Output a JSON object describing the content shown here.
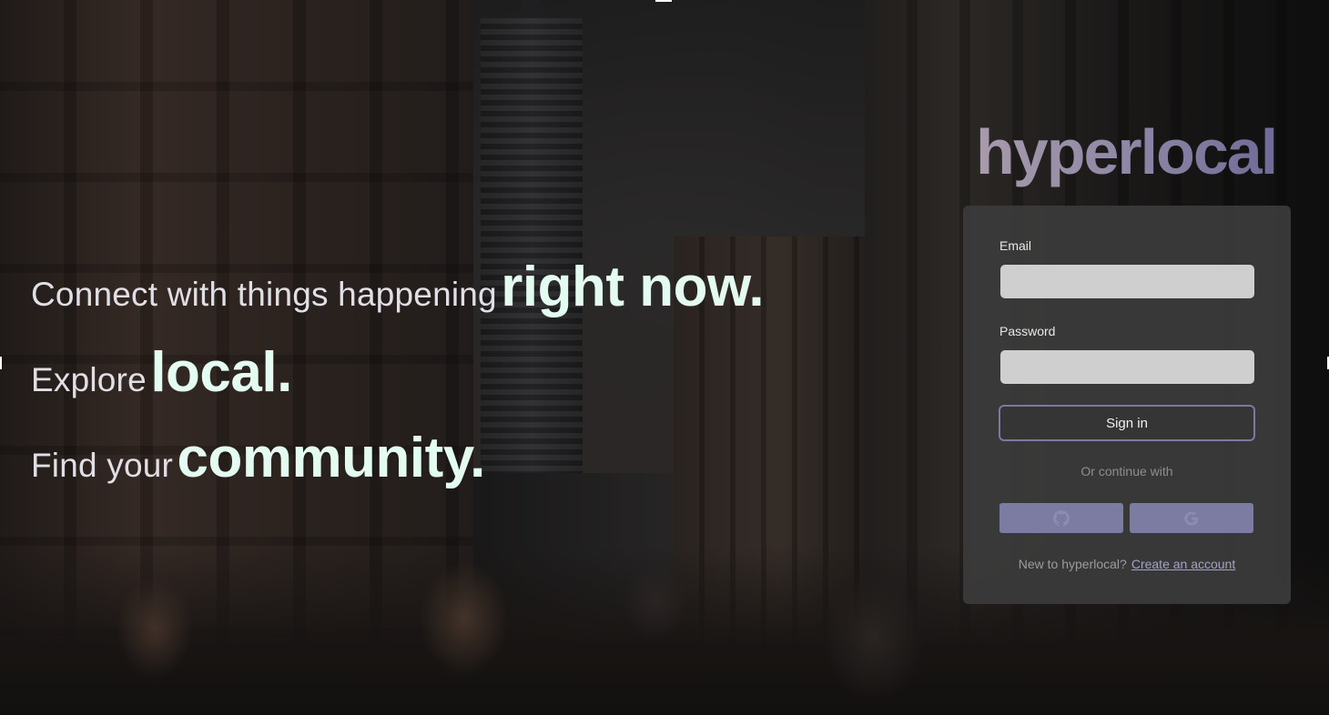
{
  "hero": {
    "line1": {
      "lead": "Connect with things happening",
      "emphasis": "right now."
    },
    "line2": {
      "lead": "Explore",
      "emphasis": "local."
    },
    "line3": {
      "lead": "Find your",
      "emphasis": "community."
    }
  },
  "brand": {
    "name": "hyperlocal"
  },
  "login": {
    "email_label": "Email",
    "email_value": "",
    "password_label": "Password",
    "password_value": "",
    "signin_label": "Sign in",
    "divider_text": "Or continue with",
    "oauth": [
      {
        "provider": "GitHub",
        "icon": "github-icon"
      },
      {
        "provider": "Google",
        "icon": "google-icon"
      }
    ],
    "footer_text": "New to hyperlocal?",
    "create_account_label": "Create an account"
  },
  "colors": {
    "accent": "#7c7ba1",
    "emphasis_text": "#e4fbf1",
    "card_bg": "#3a3a3a",
    "input_bg": "#cfcfcf"
  }
}
